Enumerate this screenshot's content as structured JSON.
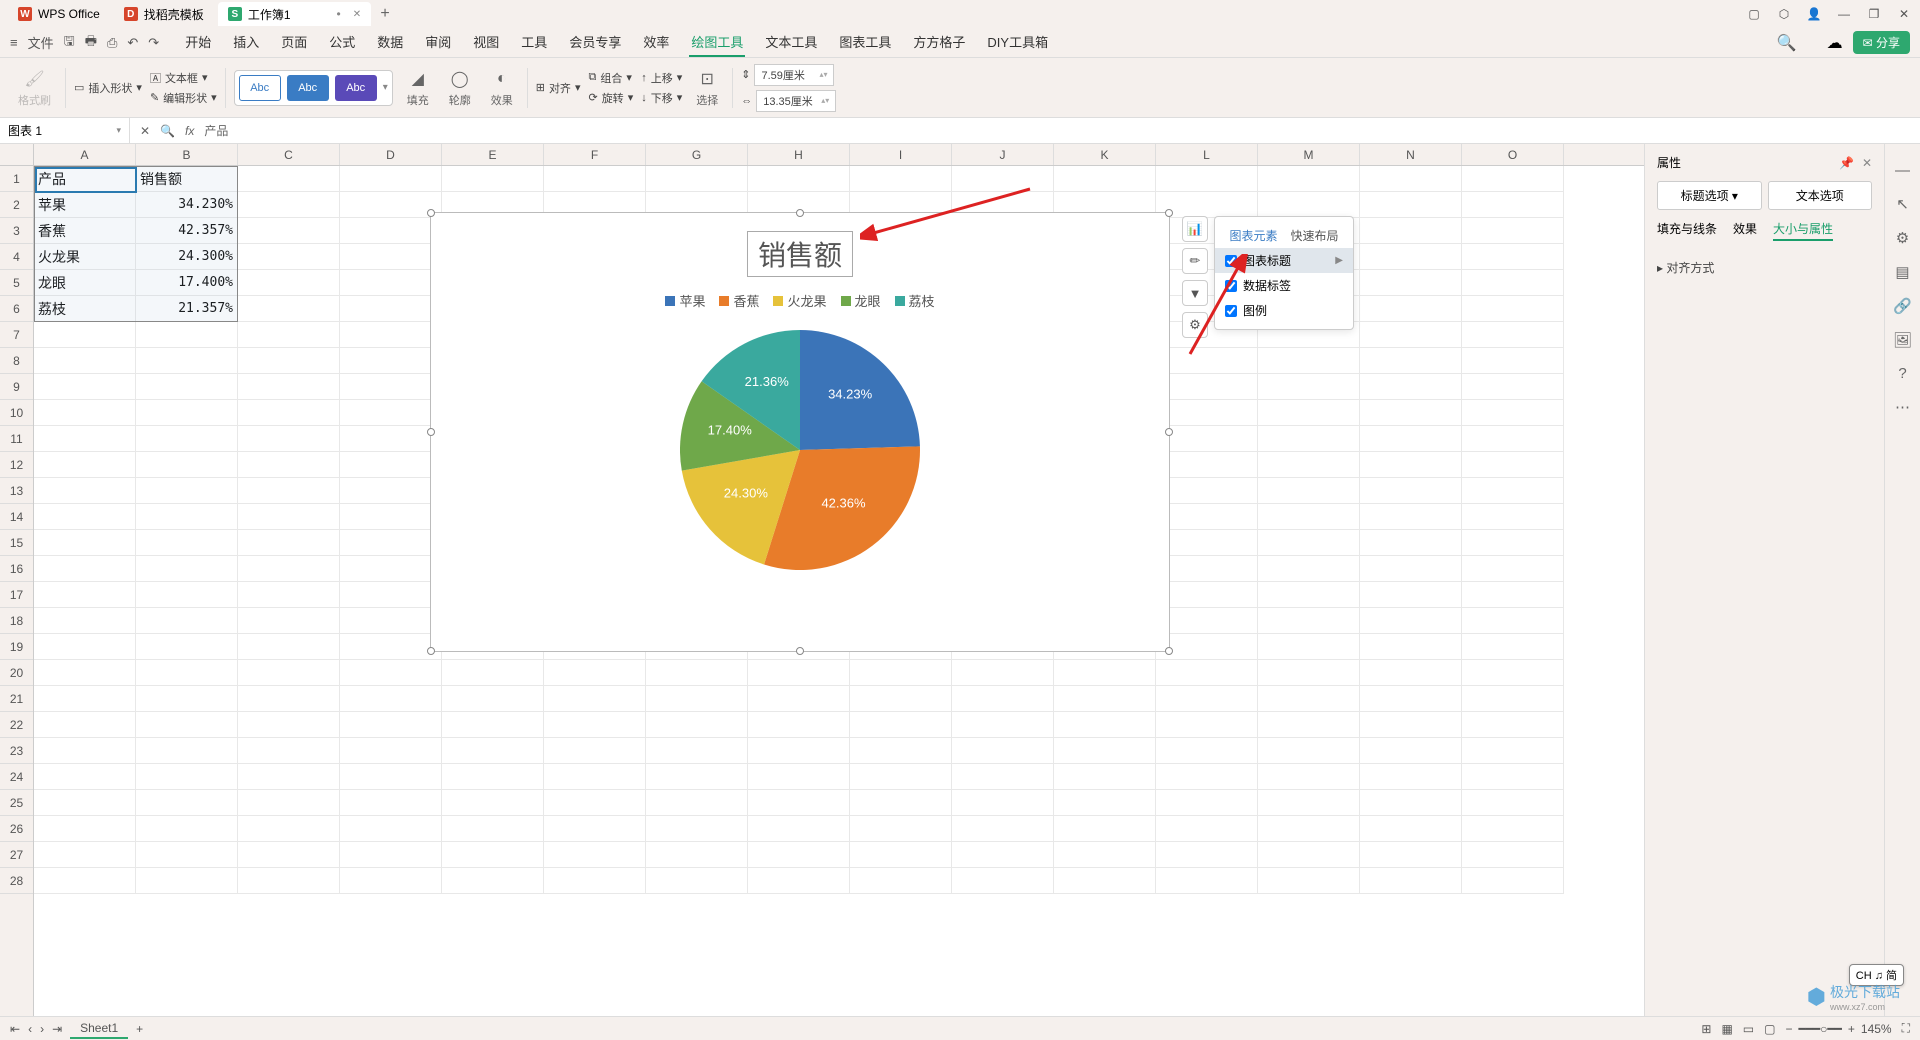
{
  "titlebar": {
    "tabs": [
      {
        "icon_bg": "#d6452b",
        "icon_text": "W",
        "label": "WPS Office"
      },
      {
        "icon_bg": "#d6452b",
        "icon_text": "D",
        "label": "找稻壳模板"
      },
      {
        "icon_bg": "#2ea86f",
        "icon_text": "S",
        "label": "工作簿1",
        "active": true,
        "dirty": "•"
      }
    ]
  },
  "menubar": {
    "file": "文件",
    "tabs": [
      "开始",
      "插入",
      "页面",
      "公式",
      "数据",
      "审阅",
      "视图",
      "工具",
      "会员专享",
      "效率",
      "绘图工具",
      "文本工具",
      "图表工具",
      "方方格子",
      "DIY工具箱"
    ],
    "active": "绘图工具",
    "share": "分享"
  },
  "ribbon": {
    "g1": "格式刷",
    "g2a": "插入形状",
    "g2b": "文本框",
    "g2c": "编辑形状",
    "styles": [
      "Abc",
      "Abc",
      "Abc"
    ],
    "fill": "填充",
    "outline": "轮廓",
    "effect": "效果",
    "align": "对齐",
    "group": "组合",
    "rotate": "旋转",
    "up": "上移",
    "down": "下移",
    "select": "选择",
    "h": "7.59厘米",
    "w": "13.35厘米"
  },
  "formula": {
    "name": "图表 1",
    "fx": "产品"
  },
  "cols": [
    "A",
    "B",
    "C",
    "D",
    "E",
    "F",
    "G",
    "H",
    "I",
    "J",
    "K",
    "L",
    "M",
    "N",
    "O"
  ],
  "rows": 28,
  "table": {
    "headers": [
      "产品",
      "销售额"
    ],
    "data": [
      [
        "苹果",
        "34.230%"
      ],
      [
        "香蕉",
        "42.357%"
      ],
      [
        "火龙果",
        "24.300%"
      ],
      [
        "龙眼",
        "17.400%"
      ],
      [
        "荔枝",
        "21.357%"
      ]
    ]
  },
  "chart_data": {
    "type": "pie",
    "title": "销售额",
    "categories": [
      "苹果",
      "香蕉",
      "火龙果",
      "龙眼",
      "荔枝"
    ],
    "values": [
      34.23,
      42.36,
      24.3,
      17.4,
      21.36
    ],
    "labels": [
      "34.23%",
      "42.36%",
      "24.30%",
      "17.40%",
      "21.36%"
    ],
    "colors": [
      "#3b74b8",
      "#e87c2a",
      "#e6c23a",
      "#6fa84a",
      "#3aa99e"
    ]
  },
  "popover": {
    "tab1": "图表元素",
    "tab2": "快速布局",
    "items": [
      {
        "label": "图表标题",
        "checked": true,
        "hl": true,
        "arrow": true
      },
      {
        "label": "数据标签",
        "checked": true
      },
      {
        "label": "图例",
        "checked": true
      }
    ]
  },
  "side": {
    "title": "属性",
    "tab1": "标题选项",
    "tab2": "文本选项",
    "sub": [
      "填充与线条",
      "效果",
      "大小与属性"
    ],
    "sub_active": "大小与属性",
    "row1": "对齐方式"
  },
  "status": {
    "sheet": "Sheet1",
    "ime": "CH ♫ 简",
    "zoom": "145%"
  },
  "watermark": {
    "main": "极光下载站",
    "sub": "www.xz7.com"
  }
}
